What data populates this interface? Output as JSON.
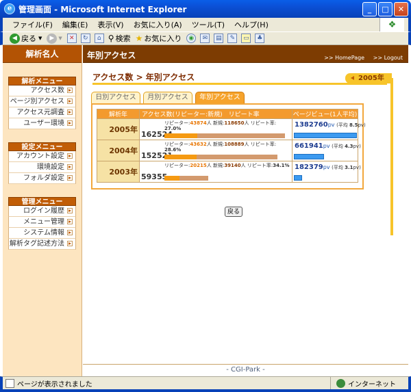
{
  "window": {
    "title": "管理画面 - Microsoft Internet Explorer"
  },
  "menubar": [
    "ファイル(F)",
    "編集(E)",
    "表示(V)",
    "お気に入り(A)",
    "ツール(T)",
    "ヘルプ(H)"
  ],
  "toolbar": {
    "back": "戻る",
    "search": "検索",
    "favorites": "お気に入り"
  },
  "sidebar": {
    "brand": "解析名人",
    "sections": [
      {
        "title": "解析メニュー",
        "items": [
          "アクセス数",
          "ページ別アクセス",
          "アクセス元調査",
          "ユーザー環境"
        ]
      },
      {
        "title": "設定メニュー",
        "items": [
          "アカウント設定",
          "環境設定",
          "フォルダ設定"
        ]
      },
      {
        "title": "管理メニュー",
        "items": [
          "ログイン履歴",
          "メニュー管理",
          "システム情報",
          "解析タグ記述方法"
        ]
      }
    ]
  },
  "header": {
    "title": "年別アクセス",
    "links": {
      "home": ">> HomePage",
      "logout": ">> Logout"
    }
  },
  "breadcrumb": "アクセス数 > 年別アクセス",
  "year_flag": "2005年",
  "tabs": [
    {
      "label": "日別アクセス",
      "active": false
    },
    {
      "label": "月別アクセス",
      "active": false
    },
    {
      "label": "年別アクセス",
      "active": true
    }
  ],
  "table": {
    "headers": {
      "year": "解析年",
      "count": "アクセス数(リピーター:新規)　リピート率",
      "pageview": "ページビュー(1人平均)"
    },
    "rows": [
      {
        "year": "2005年",
        "total": "162524",
        "repeater": "43874",
        "new": "118650",
        "rate": "27.0%",
        "pv": "1382760",
        "pv_avg": "8.5",
        "repeat_fraction": 0.27,
        "count_fraction": 1.0,
        "pv_fraction": 1.0
      },
      {
        "year": "2004年",
        "total": "152521",
        "repeater": "43632",
        "new": "108889",
        "rate": "28.6%",
        "pv": "661941",
        "pv_avg": "4.3",
        "repeat_fraction": 0.286,
        "count_fraction": 0.938,
        "pv_fraction": 0.48
      },
      {
        "year": "2003年",
        "total": "59355",
        "repeater": "20215",
        "new": "39140",
        "rate": "34.1%",
        "pv": "182379",
        "pv_avg": "3.1",
        "repeat_fraction": 0.341,
        "count_fraction": 0.365,
        "pv_fraction": 0.132
      }
    ]
  },
  "labels": {
    "repeater": "リピーター:",
    "new": "新規:",
    "rate": "リピート率:",
    "persons": "人",
    "pv_unit": "pv",
    "avg_prefix": "(平均 ",
    "avg_suffix": "pv)"
  },
  "back_button": "戻る",
  "footer": "- CGI-Park -",
  "status": {
    "text": "ページが表示されました",
    "zone": "インターネット"
  }
}
